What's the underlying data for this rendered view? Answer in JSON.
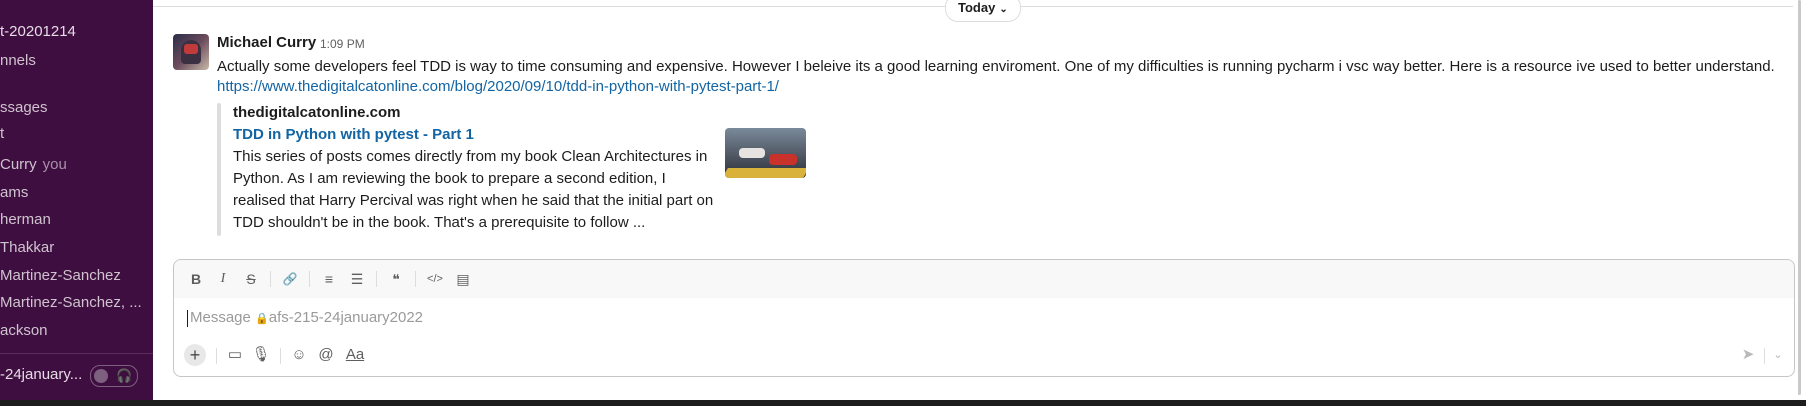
{
  "sidebar": {
    "items": [
      {
        "label": "t-20201214"
      },
      {
        "label": "nnels"
      },
      {
        "label": "ssages"
      },
      {
        "label": "t"
      },
      {
        "label": " Curry",
        "suffix": "you"
      },
      {
        "label": "ams"
      },
      {
        "label": "herman"
      },
      {
        "label": "Thakkar"
      },
      {
        "label": "Martinez-Sanchez"
      },
      {
        "label": "Martinez-Sanchez, ..."
      },
      {
        "label": "ackson"
      }
    ],
    "huddle": {
      "channel": "-24january..."
    }
  },
  "date_divider": {
    "label": "Today"
  },
  "message": {
    "sender": "Michael Curry",
    "time": "1:09 PM",
    "text": "Actually some developers feel TDD is way to time consuming and expensive. However I beleive its a good learning enviroment. One of my difficulties is running pycharm i vsc way better. Here is a resource ive used to better understand.",
    "link": "https://www.thedigitalcatonline.com/blog/2020/09/10/tdd-in-python-with-pytest-part-1/",
    "unfurl": {
      "site": "thedigitalcatonline.com",
      "title": "TDD in Python with pytest - Part 1",
      "description_lines": [
        "This series of posts comes directly from my book Clean Architectures in",
        "Python. As I am reviewing the book to prepare a second edition, I",
        "realised that Harry Percival was right when he said that the initial part on",
        "TDD shouldn't be in the book. That's a prerequisite to follow ..."
      ]
    }
  },
  "composer": {
    "placeholder_prefix": "Message ",
    "placeholder_channel": "afs-215-24january2022",
    "toolbar": {
      "bold": "B",
      "italic": "I",
      "strike": "S",
      "link": "🔗",
      "ordered_list": "≡",
      "bulleted_list": "☰",
      "blockquote": "❝",
      "code": "</>",
      "code_block": "▤"
    },
    "actions": {
      "plus": "+",
      "video": "▭",
      "mic": "🎙",
      "emoji": "☺",
      "mention": "@",
      "format": "Aa",
      "send": "➤",
      "send_options": "⌄"
    }
  }
}
